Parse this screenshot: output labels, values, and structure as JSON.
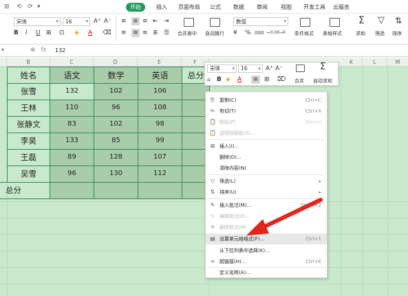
{
  "quick_access": {
    "labels": [
      "⊞",
      "⟲",
      "⟳",
      "▾"
    ]
  },
  "tabs": [
    {
      "label": "开始",
      "active": true
    },
    {
      "label": "插入"
    },
    {
      "label": "页面布局"
    },
    {
      "label": "公式"
    },
    {
      "label": "数据"
    },
    {
      "label": "审阅"
    },
    {
      "label": "视图"
    },
    {
      "label": "开发工具"
    },
    {
      "label": "云服务"
    }
  ],
  "ribbon": {
    "font_name": "宋体",
    "font_size": "16",
    "number_format": "数值",
    "merge_label": "合并居中",
    "wrap_label": "自动换行",
    "cond_format_label": "条件格式",
    "table_style_label": "表格样式",
    "sum_label": "求和",
    "filter_label": "筛选",
    "sort_label": "排序",
    "bold": "B",
    "italic": "I",
    "underline": "U",
    "pct": "%",
    "thousands": "000",
    "dec_inc": "←0.00",
    "dec_dec": "→0"
  },
  "formula_bar": {
    "fx": "fx",
    "value": "132"
  },
  "columns": [
    "B",
    "C",
    "D",
    "E",
    "F",
    "K",
    "L",
    "M"
  ],
  "table": {
    "header": [
      "姓名",
      "语文",
      "数学",
      "英语",
      "总分"
    ],
    "rows": [
      {
        "name": "张雪",
        "v": [
          "132",
          "102",
          "106"
        ]
      },
      {
        "name": "王林",
        "v": [
          "110",
          "96",
          "108"
        ]
      },
      {
        "name": "张静文",
        "v": [
          "83",
          "102",
          "98"
        ]
      },
      {
        "name": "李昊",
        "v": [
          "133",
          "85",
          "99"
        ]
      },
      {
        "name": "王磊",
        "v": [
          "89",
          "128",
          "107"
        ]
      },
      {
        "name": "吴雪",
        "v": [
          "96",
          "130",
          "112"
        ]
      }
    ],
    "total_label": "总分"
  },
  "mini_toolbar": {
    "font_name": "宋体",
    "font_size": "16",
    "grow": "A⁺",
    "shrink": "A⁻",
    "bold": "B",
    "merge_label": "合并",
    "autosum_label": "自动求和"
  },
  "context_menu": {
    "items": [
      {
        "icon": "⎘",
        "label": "复制(C)",
        "shortcut": "Ctrl+C"
      },
      {
        "icon": "✂",
        "label": "剪切(T)",
        "shortcut": "Ctrl+X"
      },
      {
        "icon": "📋",
        "label": "粘贴(P)",
        "shortcut": "Ctrl+V",
        "disabled": true
      },
      {
        "icon": "📋",
        "label": "选择性粘贴(S)...",
        "shortcut": "",
        "disabled": true
      },
      {
        "icon": "⊞",
        "label": "插入(I)...",
        "shortcut": ""
      },
      {
        "icon": "",
        "label": "删除(D)...",
        "shortcut": ""
      },
      {
        "icon": "",
        "label": "清除内容(N)",
        "shortcut": ""
      },
      {
        "icon": "▽",
        "label": "筛选(L)",
        "shortcut": "▸"
      },
      {
        "icon": "⇅",
        "label": "排序(U)",
        "shortcut": "▸"
      },
      {
        "icon": "✎",
        "label": "插入批注(M)...",
        "shortcut": "Shift+F2"
      },
      {
        "icon": "✎",
        "label": "编辑批注(E)...",
        "shortcut": "",
        "disabled": true
      },
      {
        "icon": "✖",
        "label": "删除批注(M)",
        "shortcut": "",
        "disabled": true
      },
      {
        "icon": "▤",
        "label": "设置单元格格式(F)...",
        "shortcut": "Ctrl+1",
        "highlighted": true
      },
      {
        "icon": "",
        "label": "从下拉列表中选择(K)...",
        "shortcut": ""
      },
      {
        "icon": "∞",
        "label": "超链接(H)...",
        "shortcut": "Ctrl+K"
      },
      {
        "icon": "",
        "label": "定义名称(A)...",
        "shortcut": ""
      }
    ]
  },
  "colors": {
    "accent": "#1e9a5d",
    "selection": "#a9cdaa",
    "sheet": "#c8e9cb",
    "arrow": "#e0261d"
  }
}
